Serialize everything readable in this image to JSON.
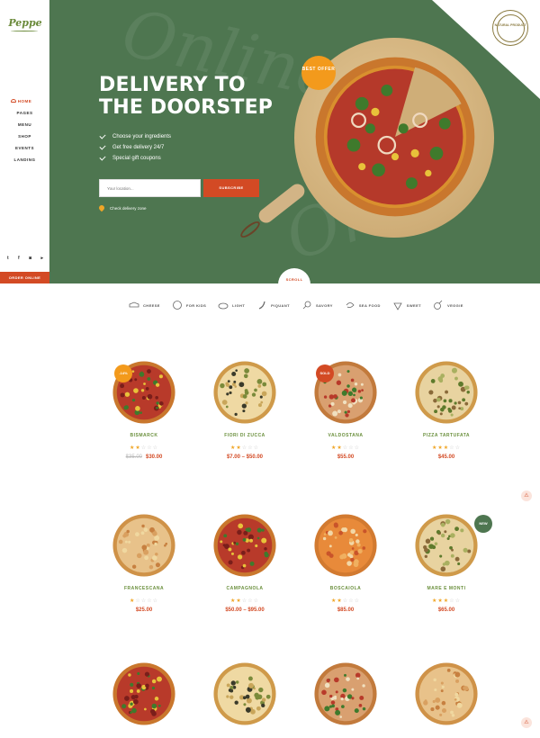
{
  "brand": {
    "logo": "Peppe"
  },
  "sidebar": {
    "items": [
      {
        "label": "HOME",
        "active": true
      },
      {
        "label": "PAGES",
        "active": false
      },
      {
        "label": "MENU",
        "active": false
      },
      {
        "label": "SHOP",
        "active": false
      },
      {
        "label": "EVENTS",
        "active": false
      },
      {
        "label": "LANDING",
        "active": false
      }
    ],
    "socials": [
      "twitter-icon",
      "facebook-icon",
      "instagram-icon",
      "youtube-icon"
    ],
    "order_label": "ORDER ONLINE"
  },
  "hero": {
    "bg_script_1": "Online",
    "bg_script_2": "Order",
    "title": "DELIVERY TO THE DOORSTEP",
    "benefits": [
      "Choose your ingredients",
      "Get free delivery 24/7",
      "Special gift coupons"
    ],
    "input_placeholder": "Your location...",
    "subscribe_label": "SUBSCRIBE",
    "check_zone_label": "Check delivery zone",
    "best_offer": "BEST OFFER",
    "badge_text": "NATURAL PRODUCT",
    "scroll_label": "SCROLL"
  },
  "categories": [
    {
      "label": "CHEESE",
      "icon": "cheese-icon"
    },
    {
      "label": "FOR KIDS",
      "icon": "kids-icon"
    },
    {
      "label": "LIGHT",
      "icon": "light-icon"
    },
    {
      "label": "PIQUANT",
      "icon": "chili-icon"
    },
    {
      "label": "SAVORY",
      "icon": "drumstick-icon"
    },
    {
      "label": "SEA FOOD",
      "icon": "shrimp-icon"
    },
    {
      "label": "SWEET",
      "icon": "strawberry-icon"
    },
    {
      "label": "VEGGIE",
      "icon": "veggie-icon"
    }
  ],
  "products": [
    {
      "name": "BISMARCK",
      "rating": 2,
      "old_price": "$35.00",
      "price": "$30.00",
      "tag": "-14%",
      "tag_color": "#f39a1c",
      "style": "red"
    },
    {
      "name": "FIORI DI ZUCCA",
      "rating": 2,
      "old_price": "",
      "price": "$7.00 – $50.00",
      "tag": "",
      "tag_color": "",
      "style": "cheese"
    },
    {
      "name": "VALDOSTANA",
      "rating": 2,
      "old_price": "",
      "price": "$55.00",
      "tag": "SOLD",
      "tag_color": "#d34a24",
      "style": "mixed"
    },
    {
      "name": "PIZZA TARTUFATA",
      "rating": 3,
      "old_price": "",
      "price": "$45.00",
      "tag": "",
      "tag_color": "",
      "style": "herb"
    },
    {
      "name": "FRANCESCANA",
      "rating": 1,
      "old_price": "",
      "price": "$25.00",
      "tag": "",
      "tag_color": "",
      "style": "plain"
    },
    {
      "name": "CAMPAGNOLA",
      "rating": 2,
      "old_price": "",
      "price": "$50.00 – $95.00",
      "tag": "",
      "tag_color": "",
      "style": "red"
    },
    {
      "name": "BOSCAIOLA",
      "rating": 2,
      "old_price": "",
      "price": "$85.00",
      "tag": "",
      "tag_color": "",
      "style": "orange"
    },
    {
      "name": "MARE E MONTI",
      "rating": 3,
      "old_price": "",
      "price": "$65.00",
      "tag": "NEW",
      "tag_color": "#4e7650",
      "style": "herb"
    },
    {
      "name": "",
      "rating": 0,
      "old_price": "",
      "price": "",
      "tag": "",
      "tag_color": "",
      "style": "red"
    },
    {
      "name": "",
      "rating": 0,
      "old_price": "",
      "price": "",
      "tag": "",
      "tag_color": "",
      "style": "cheese"
    },
    {
      "name": "",
      "rating": 0,
      "old_price": "",
      "price": "",
      "tag": "",
      "tag_color": "",
      "style": "mixed"
    },
    {
      "name": "",
      "rating": 0,
      "old_price": "",
      "price": "",
      "tag": "",
      "tag_color": "",
      "style": "plain"
    }
  ],
  "colors": {
    "accent": "#d34a24",
    "hero_bg": "#4e7650",
    "green_text": "#6a8f3c",
    "star": "#f0a627"
  }
}
